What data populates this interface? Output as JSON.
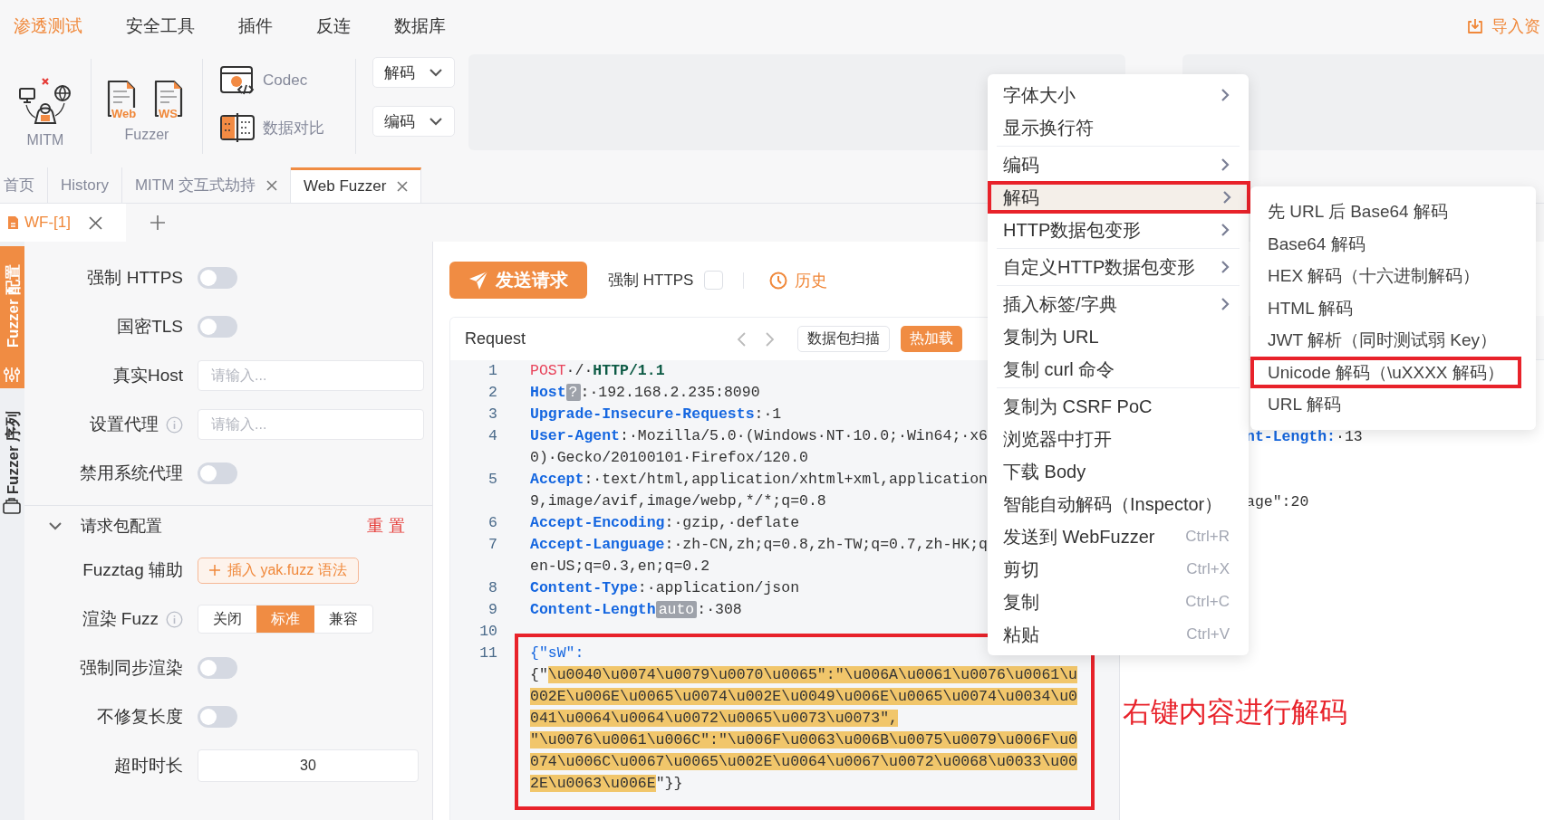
{
  "top_menu": [
    {
      "label": "渗透测试",
      "selected": true
    },
    {
      "label": "安全工具",
      "selected": false
    },
    {
      "label": "插件",
      "selected": false
    },
    {
      "label": "反连",
      "selected": false
    },
    {
      "label": "数据库",
      "selected": false
    }
  ],
  "import_link": "导入资",
  "toolbar": {
    "mitm": "MITM",
    "fuzzer": {
      "label": "Fuzzer",
      "items": [
        "Web",
        "WS"
      ]
    },
    "tools": [
      {
        "kind": "codec",
        "label": "Codec"
      },
      {
        "kind": "compare",
        "label": "数据对比"
      }
    ],
    "dropdowns": [
      "解码",
      "编码"
    ]
  },
  "tabs": [
    {
      "label": "首页",
      "closable": false,
      "selected": false
    },
    {
      "label": "History",
      "closable": false,
      "selected": false
    },
    {
      "label": "MITM 交互式劫持",
      "closable": true,
      "selected": false
    },
    {
      "label": "Web Fuzzer",
      "closable": true,
      "selected": true
    }
  ],
  "subtabs": [
    {
      "label": "WF-[1]",
      "selected": true
    }
  ],
  "side_tabs": [
    {
      "kind": "config",
      "label": "Fuzzer 配置",
      "selected": true
    },
    {
      "kind": "sequence",
      "label": "Fuzzer 序列",
      "selected": false
    }
  ],
  "settings": [
    {
      "kind": "switch",
      "label": "强制 HTTPS",
      "info": false,
      "on": false
    },
    {
      "kind": "switch",
      "label": "国密TLS",
      "info": false,
      "on": false
    },
    {
      "kind": "input",
      "label": "真实Host",
      "info": false,
      "placeholder": "请输入..."
    },
    {
      "kind": "input",
      "label": "设置代理",
      "info": true,
      "placeholder": "请输入..."
    },
    {
      "kind": "switch",
      "label": "禁用系统代理",
      "info": false,
      "on": false
    }
  ],
  "section": {
    "title": "请求包配置",
    "expanded": true,
    "action": "重置"
  },
  "section_items": [
    {
      "kind": "button",
      "label": "Fuzztag 辅助",
      "info": false,
      "button": "插入 yak.fuzz 语法"
    },
    {
      "kind": "segmented",
      "label": "渲染 Fuzz",
      "info": true,
      "options": [
        {
          "label": "关闭",
          "selected": false
        },
        {
          "label": "标准",
          "selected": true
        },
        {
          "label": "兼容",
          "selected": false
        }
      ]
    },
    {
      "kind": "switch",
      "label": "强制同步渲染",
      "info": false,
      "on": false
    },
    {
      "kind": "switch",
      "label": "不修复长度",
      "info": false,
      "on": false
    },
    {
      "kind": "number",
      "label": "超时时长",
      "info": false,
      "value": "30"
    }
  ],
  "send_button": "发送请求",
  "force_https": {
    "label": "强制 HTTPS",
    "checked": false
  },
  "history": "历史",
  "request": {
    "title": "Request",
    "buttons": [
      {
        "kind": "outline",
        "label": "数据包扫描"
      },
      {
        "kind": "primary",
        "label": "热加载"
      }
    ],
    "lines": [
      {
        "num": "1",
        "annotated": false,
        "rows": [
          [
            {
              "kind": "method",
              "text": "POST"
            },
            {
              "kind": "plain",
              "text": "·/·"
            },
            {
              "kind": "version",
              "text": "HTTP/1.1"
            }
          ]
        ]
      },
      {
        "num": "2",
        "annotated": false,
        "rows": [
          [
            {
              "kind": "key",
              "text": "Host"
            },
            {
              "kind": "chip",
              "text": "?"
            },
            {
              "kind": "plain",
              "text": ":·192.168.2.235:8090"
            }
          ]
        ]
      },
      {
        "num": "3",
        "annotated": false,
        "rows": [
          [
            {
              "kind": "key",
              "text": "Upgrade-Insecure-Requests"
            },
            {
              "kind": "plain",
              "text": ":·1"
            }
          ]
        ]
      },
      {
        "num": "4",
        "annotated": false,
        "rows": [
          [
            {
              "kind": "key",
              "text": "User-Agent"
            },
            {
              "kind": "plain",
              "text": ":·Mozilla/5.0·(Windows·NT·10.0;·Win64;·x6"
            }
          ],
          [
            {
              "kind": "plain",
              "text": "0)·Gecko/20100101·Firefox/120.0"
            }
          ]
        ]
      },
      {
        "num": "5",
        "annotated": false,
        "rows": [
          [
            {
              "kind": "key",
              "text": "Accept"
            },
            {
              "kind": "plain",
              "text": ":·text/html,application/xhtml+xml,application"
            }
          ],
          [
            {
              "kind": "plain",
              "text": "9,image/avif,image/webp,*/*;q=0.8"
            }
          ]
        ]
      },
      {
        "num": "6",
        "annotated": false,
        "rows": [
          [
            {
              "kind": "key",
              "text": "Accept-Encoding"
            },
            {
              "kind": "plain",
              "text": ":·gzip,·deflate"
            }
          ]
        ]
      },
      {
        "num": "7",
        "annotated": false,
        "rows": [
          [
            {
              "kind": "key",
              "text": "Accept-Language"
            },
            {
              "kind": "plain",
              "text": ":·zh-CN,zh;q=0.8,zh-TW;q=0.7,zh-HK;q"
            }
          ],
          [
            {
              "kind": "plain",
              "text": "en-US;q=0.3,en;q=0.2"
            }
          ]
        ]
      },
      {
        "num": "8",
        "annotated": false,
        "rows": [
          [
            {
              "kind": "key",
              "text": "Content-Type"
            },
            {
              "kind": "plain",
              "text": ":·application/json"
            }
          ]
        ]
      },
      {
        "num": "9",
        "annotated": false,
        "rows": [
          [
            {
              "kind": "key",
              "text": "Content-Length"
            },
            {
              "kind": "chip",
              "text": "auto"
            },
            {
              "kind": "plain",
              "text": ":·308"
            }
          ]
        ]
      },
      {
        "num": "10",
        "annotated": false
      },
      {
        "num": "11",
        "annotated": true,
        "rows": [
          [
            {
              "kind": "json",
              "text": "{\"sW\":"
            }
          ],
          [
            {
              "kind": "plain",
              "text": "{\""
            },
            {
              "kind": "sel",
              "text": "\\u0040\\u0074\\u0079\\u0070\\u0065\":\"\\u006A\\u0061\\u0076\\u0061\\u"
            }
          ],
          [
            {
              "kind": "sel",
              "text": "002E\\u006E\\u0065\\u0074\\u002E\\u0049\\u006E\\u0065\\u0074\\u0034\\u0"
            }
          ],
          [
            {
              "kind": "sel",
              "text": "041\\u0064\\u0064\\u0072\\u0065\\u0073\\u0073\","
            }
          ],
          [
            {
              "kind": "sel",
              "text": "\"\\u0076\\u0061\\u006C\":\"\\u006F\\u0063\\u006B\\u0075\\u0079\\u006F\\u0"
            }
          ],
          [
            {
              "kind": "sel",
              "text": "074\\u006C\\u0067\\u0065\\u002E\\u0064\\u0067\\u0072\\u0068\\u0033\\u00"
            }
          ],
          [
            {
              "kind": "sel",
              "text": "2E\\u0063\\u006E"
            },
            {
              "kind": "plain",
              "text": "\"}}"
            }
          ]
        ]
      }
    ]
  },
  "response": {
    "lines": [
      [
        {
          "kind": "key",
          "text": "nt-Length:"
        },
        {
          "kind": "plain",
          "text": "·13"
        }
      ],
      [
        {
          "kind": "plain",
          "text": "age\":20"
        }
      ]
    ]
  },
  "context_menu": [
    {
      "label": "字体大小",
      "submenu": true,
      "divider_after": false,
      "selected": false,
      "annotated": false
    },
    {
      "label": "显示换行符",
      "submenu": false,
      "divider_after": true,
      "selected": false,
      "annotated": false
    },
    {
      "label": "编码",
      "submenu": true,
      "divider_after": false,
      "selected": false,
      "annotated": false
    },
    {
      "label": "解码",
      "submenu": true,
      "divider_after": false,
      "selected": true,
      "annotated": true
    },
    {
      "label": "HTTP数据包变形",
      "submenu": true,
      "divider_after": true,
      "selected": false,
      "annotated": false
    },
    {
      "label": "自定义HTTP数据包变形",
      "submenu": true,
      "divider_after": true,
      "selected": false,
      "annotated": false
    },
    {
      "label": "插入标签/字典",
      "submenu": true,
      "divider_after": false,
      "selected": false,
      "annotated": false
    },
    {
      "label": "复制为 URL",
      "submenu": false,
      "divider_after": false,
      "selected": false,
      "annotated": false
    },
    {
      "label": "复制 curl 命令",
      "submenu": false,
      "divider_after": true,
      "selected": false,
      "annotated": false
    },
    {
      "label": "复制为 CSRF PoC",
      "submenu": false,
      "divider_after": false,
      "selected": false,
      "annotated": false
    },
    {
      "label": "浏览器中打开",
      "submenu": false,
      "divider_after": false,
      "selected": false,
      "annotated": false
    },
    {
      "label": "下载 Body",
      "submenu": false,
      "divider_after": false,
      "selected": false,
      "annotated": false
    },
    {
      "label": "智能自动解码（Inspector）",
      "submenu": false,
      "divider_after": false,
      "selected": false,
      "annotated": false
    },
    {
      "label": "发送到 WebFuzzer",
      "shortcut": "Ctrl+R",
      "submenu": false,
      "divider_after": false,
      "selected": false,
      "annotated": false
    },
    {
      "label": "剪切",
      "shortcut": "Ctrl+X",
      "submenu": false,
      "divider_after": false,
      "selected": false,
      "annotated": false
    },
    {
      "label": "复制",
      "shortcut": "Ctrl+C",
      "submenu": false,
      "divider_after": false,
      "selected": false,
      "annotated": false
    },
    {
      "label": "粘贴",
      "shortcut": "Ctrl+V",
      "submenu": false,
      "divider_after": false,
      "selected": false,
      "annotated": false
    }
  ],
  "submenu": [
    {
      "label": "先 URL 后 Base64 解码",
      "annotated": false
    },
    {
      "label": "Base64 解码",
      "annotated": false
    },
    {
      "label": "HEX 解码（十六进制解码）",
      "annotated": false
    },
    {
      "label": "HTML 解码",
      "annotated": false
    },
    {
      "label": "JWT 解析（同时测试弱 Key）",
      "annotated": false
    },
    {
      "label": "Unicode 解码（\\uXXXX 解码）",
      "annotated": true
    },
    {
      "label": "URL 解码",
      "annotated": false
    }
  ],
  "annotation": "右键内容进行解码"
}
